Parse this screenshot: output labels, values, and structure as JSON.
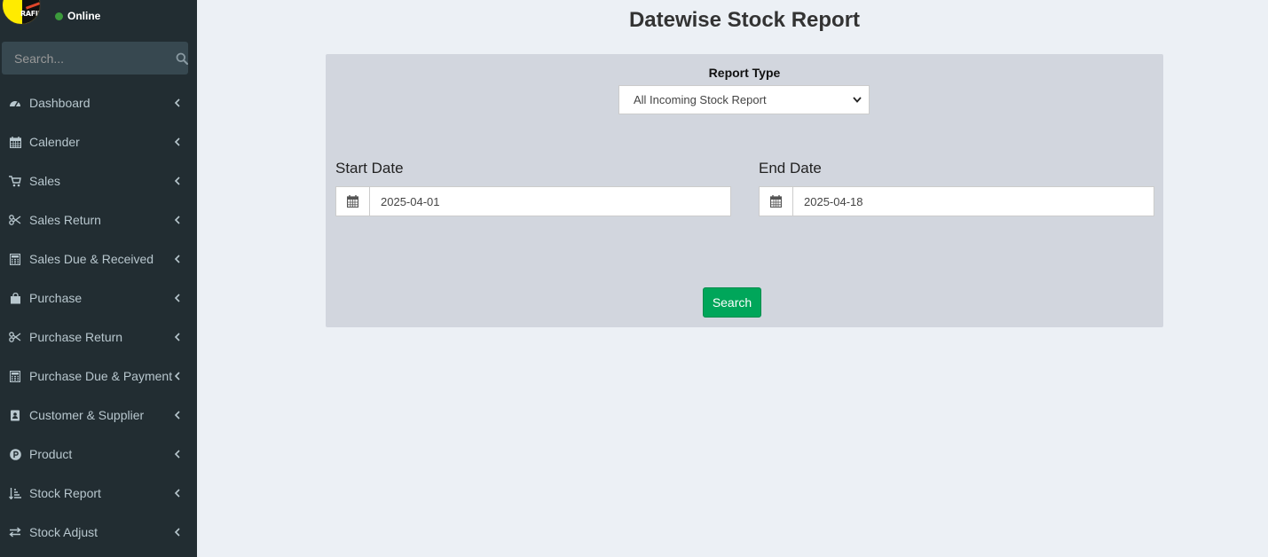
{
  "user": {
    "status_label": "Online",
    "avatar_text": "RAFIN"
  },
  "sidebar": {
    "search_placeholder": "Search...",
    "items": [
      {
        "label": "Dashboard",
        "icon": "dashboard-icon"
      },
      {
        "label": "Calender",
        "icon": "calendar-icon"
      },
      {
        "label": "Sales",
        "icon": "cart-icon"
      },
      {
        "label": "Sales Return",
        "icon": "scissors-icon"
      },
      {
        "label": "Sales Due & Received",
        "icon": "calculator-icon"
      },
      {
        "label": "Purchase",
        "icon": "shopping-bag-icon"
      },
      {
        "label": "Purchase Return",
        "icon": "scissors-icon"
      },
      {
        "label": "Purchase Due & Payment",
        "icon": "calculator-icon"
      },
      {
        "label": "Customer & Supplier",
        "icon": "address-book-icon"
      },
      {
        "label": "Product",
        "icon": "product-p-icon"
      },
      {
        "label": "Stock Report",
        "icon": "sort-amount-icon"
      },
      {
        "label": "Stock Adjust",
        "icon": "exchange-icon"
      }
    ]
  },
  "page": {
    "title": "Datewise Stock Report"
  },
  "form": {
    "report_type_label": "Report Type",
    "report_type_value": "All Incoming Stock Report",
    "start_date_label": "Start Date",
    "start_date_value": "2025-04-01",
    "end_date_label": "End Date",
    "end_date_value": "2025-04-18",
    "search_button_label": "Search"
  },
  "colors": {
    "sidebar_bg": "#222d32",
    "content_bg": "#ecf0f5",
    "panel_bg": "#d2d6de",
    "success_button": "#00a65a",
    "online_dot": "#3c9a3c"
  }
}
